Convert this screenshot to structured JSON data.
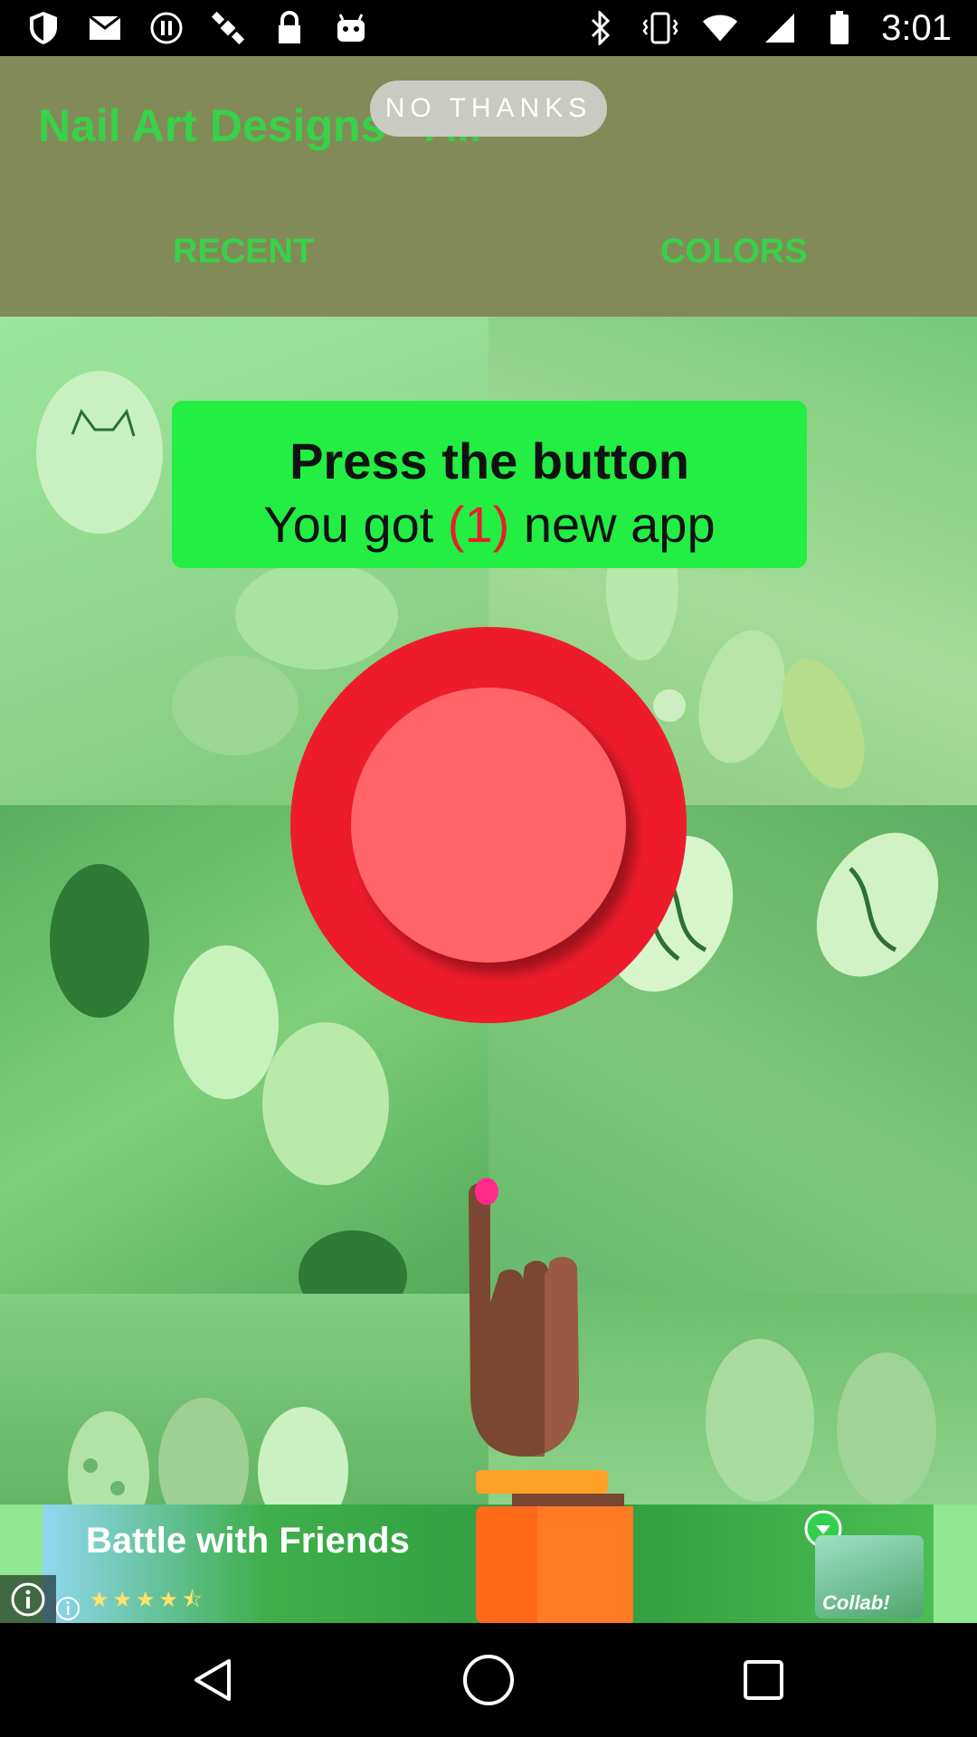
{
  "status_bar": {
    "time": "3:01",
    "left_icons": [
      "shield-icon",
      "message-icon",
      "pause-icon",
      "satellite-icon",
      "lock-icon",
      "android-icon"
    ],
    "right_icons": [
      "bluetooth-icon",
      "vibrate-icon",
      "wifi-icon",
      "signal-icon",
      "battery-icon"
    ]
  },
  "app_bar": {
    "title": "Nail Art Designs - All",
    "tabs": [
      {
        "label": "RECENT"
      },
      {
        "label": "COLORS"
      }
    ]
  },
  "overlay": {
    "no_thanks_label": "NO THANKS",
    "prompt_title": "Press the button",
    "prompt_sub_before": "You got ",
    "prompt_sub_count": "(1)",
    "prompt_sub_after": " new app"
  },
  "ad": {
    "headline": "Battle with Friends",
    "rating_stars": "★★★★⯪",
    "art_label": "Collab!"
  },
  "colors": {
    "accent_green": "#37d14a",
    "prompt_bg": "#22ee44",
    "button_red": "#ee1c2b",
    "button_inner": "#ff6467"
  }
}
